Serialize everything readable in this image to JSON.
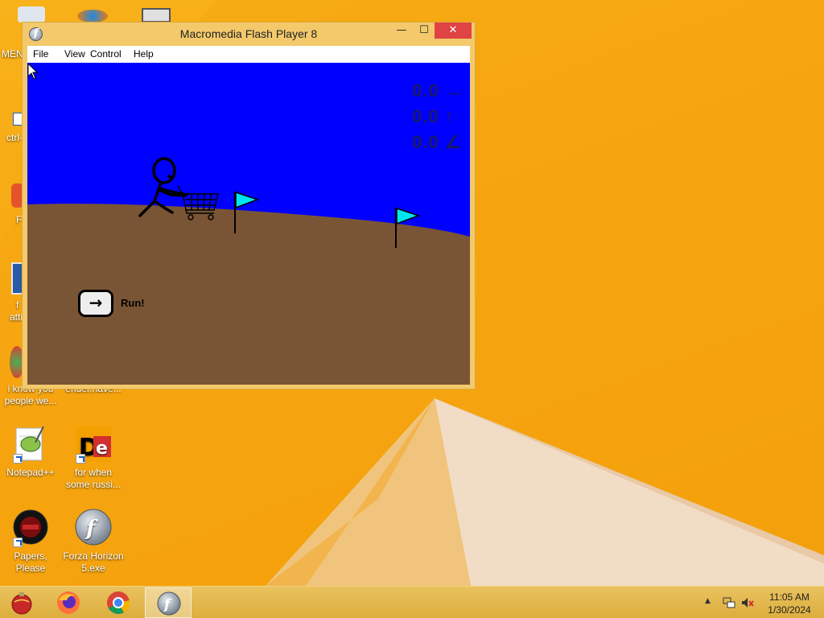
{
  "window": {
    "title": "Macromedia Flash Player 8",
    "menu": [
      "File",
      "View",
      "Control",
      "Help"
    ],
    "controls": {
      "minimize": "—",
      "maximize": "☐",
      "close": "✕"
    }
  },
  "game": {
    "hud": [
      "0.0 →",
      "0.0 ↑",
      "0.0 ∠"
    ],
    "run_button_symbol": "→",
    "run_label": "Run!",
    "colors": {
      "sky": "#0000ff",
      "ground": "#7a5535",
      "flag": "#00e5f5"
    }
  },
  "desktop": {
    "edge_labels": [
      "MEN",
      "ctrl-",
      "F",
      "f",
      "atti"
    ],
    "icons": [
      {
        "label": "i know you\npeople we..."
      },
      {
        "label": "ender.nave..."
      },
      {
        "label": "Notepad++"
      },
      {
        "label": "for when\nsome russi..."
      },
      {
        "label": "Papers, Please"
      },
      {
        "label": "Forza Horizon\n5.exe"
      }
    ]
  },
  "taskbar": {
    "time": "11:05 AM",
    "date": "1/30/2024",
    "tray_chevron": "▲"
  }
}
